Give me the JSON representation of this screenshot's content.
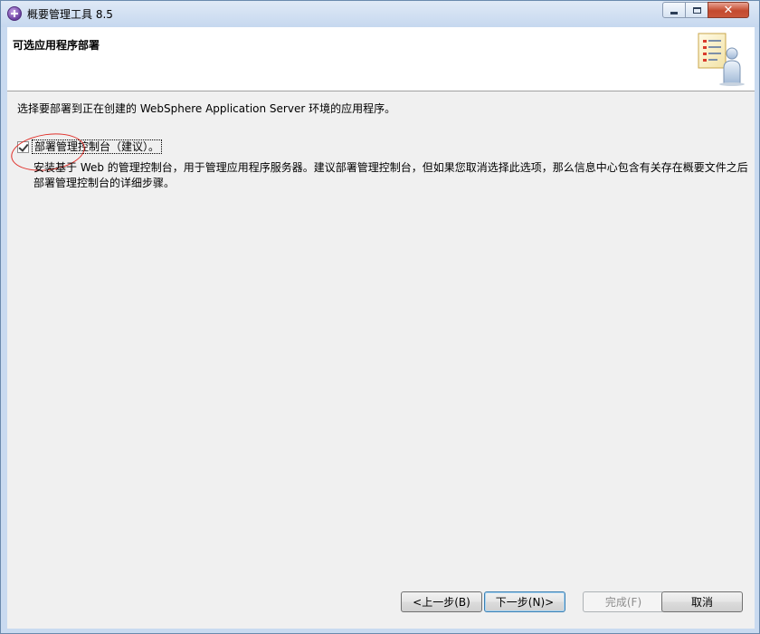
{
  "window": {
    "title": "概要管理工具 8.5",
    "icon": "ibm-globe-icon"
  },
  "banner": {
    "title": "可选应用程序部署",
    "graphic": "wizard-checklist-person-icon"
  },
  "description": "选择要部署到正在创建的 WebSphere Application Server 环境的应用程序。",
  "option": {
    "label": "部署管理控制台（建议）。",
    "checked": true,
    "detail": "安装基于 Web 的管理控制台，用于管理应用程序服务器。建议部署管理控制台，但如果您取消选择此选项，那么信息中心包含有关存在概要文件之后部署管理控制台的详细步骤。"
  },
  "buttons": {
    "back": "<上一步(B)",
    "next": "下一步(N)>",
    "finish": "完成(F)",
    "cancel": "取消"
  },
  "colors": {
    "annotation_oval": "#e0302a",
    "titlebar": "#c9daf0",
    "close_button": "#c44a2f"
  }
}
